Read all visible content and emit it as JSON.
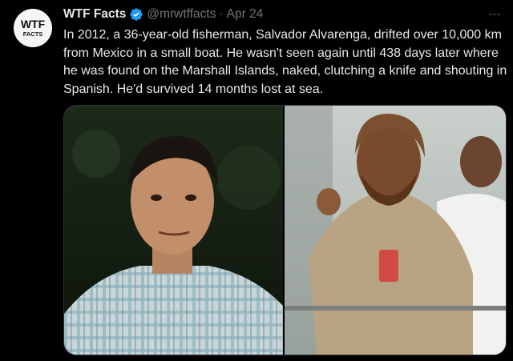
{
  "tweet": {
    "avatar_text": [
      "WTF",
      "FACTS"
    ],
    "display_name": "WTF Facts",
    "handle": "@mrwtffacts",
    "separator": "·",
    "timestamp": "Apr 24",
    "more_icon": "⋯",
    "text": "In 2012, a 36-year-old fisherman, Salvador Alvarenga, drifted over 10,000 km from Mexico in a small boat. He wasn't seen again until 438 days later where he was found on the Marshall Islands, naked, clutching a knife and shouting in Spanish. He'd survived 14 months lost at sea.",
    "verified_color": "#1d9bf0"
  },
  "media": {
    "photos": [
      {
        "icon": "portrait-photo"
      },
      {
        "icon": "rescue-photo"
      }
    ]
  }
}
